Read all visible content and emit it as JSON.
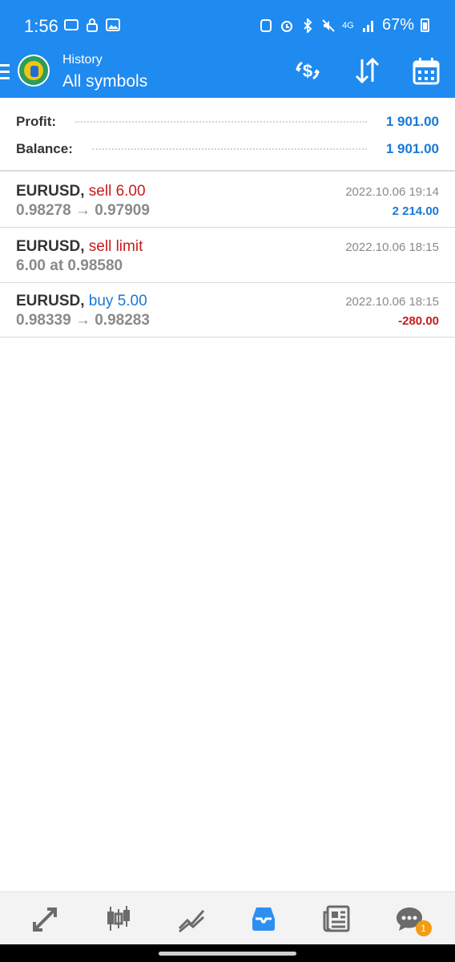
{
  "status_bar": {
    "time": "1:56",
    "battery": "67%",
    "network": "4G"
  },
  "header": {
    "subtitle": "History",
    "title": "All symbols",
    "actions": [
      "currency-exchange-icon",
      "sort-icon",
      "calendar-icon"
    ]
  },
  "summary": {
    "profit_label": "Profit:",
    "profit_value": "1 901.00",
    "balance_label": "Balance:",
    "balance_value": "1 901.00"
  },
  "deals": [
    {
      "symbol": "EURUSD,",
      "action": "sell 6.00",
      "type": "sell",
      "details": "0.98278 → 0.97909",
      "time": "2022.10.06 19:14",
      "profit": "2 214.00"
    },
    {
      "symbol": "EURUSD,",
      "action": "sell limit",
      "type": "sell",
      "details": "6.00 at 0.98580",
      "time": "2022.10.06 18:15",
      "profit": ""
    },
    {
      "symbol": "EURUSD,",
      "action": "buy 5.00",
      "type": "buy",
      "details": "0.98339 → 0.98283",
      "time": "2022.10.06 18:15",
      "profit": "-280.00"
    }
  ],
  "bottom_nav": {
    "items": [
      "trade-icon",
      "quotes-icon",
      "chart-icon",
      "history-icon",
      "news-icon",
      "chat-icon"
    ],
    "active": "history-icon",
    "chat_badge": "1"
  },
  "colors": {
    "header_bg": "#1f8af0",
    "positive": "#1779d8",
    "negative": "#c71c1c"
  }
}
